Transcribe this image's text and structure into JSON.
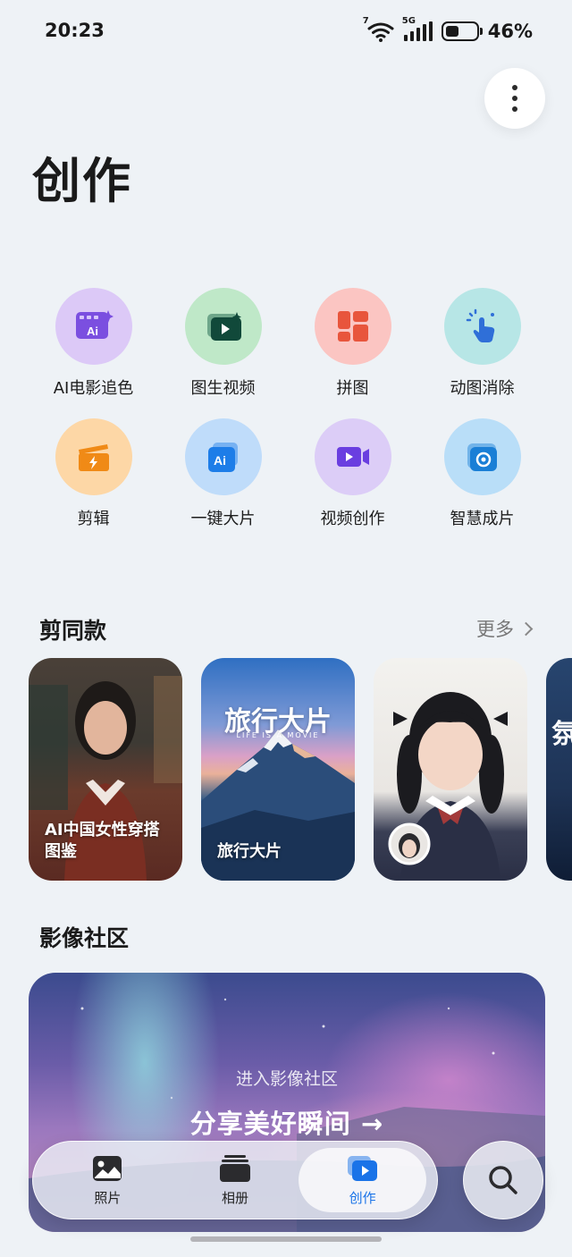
{
  "status_bar": {
    "time": "20:23",
    "network": "5G",
    "wifi_badge": "7",
    "battery": "46%",
    "battery_level": 0.46
  },
  "page": {
    "title": "创作"
  },
  "tools": [
    {
      "label": "AI电影追色",
      "icon": "ai-film-icon",
      "color": "#dcc9f7"
    },
    {
      "label": "图生视频",
      "icon": "image-to-video-icon",
      "color": "#bfe8c8"
    },
    {
      "label": "拼图",
      "icon": "collage-icon",
      "color": "#fbc5c2"
    },
    {
      "label": "动图消除",
      "icon": "motion-erase-icon",
      "color": "#b7e6e6"
    },
    {
      "label": "剪辑",
      "icon": "clip-edit-icon",
      "color": "#fdd7a6"
    },
    {
      "label": "一键大片",
      "icon": "ai-one-tap-icon",
      "color": "#bfdcfa"
    },
    {
      "label": "视频创作",
      "icon": "video-camera-icon",
      "color": "#dccdf7"
    },
    {
      "label": "智慧成片",
      "icon": "smart-film-icon",
      "color": "#b9def8"
    }
  ],
  "templates_section": {
    "title": "剪同款",
    "more_label": "更多",
    "cards": [
      {
        "label": "AI中国女性穿搭图鉴"
      },
      {
        "label": "旅行大片",
        "poster_title": "旅行大片",
        "poster_subtitle": "LIFE IS A MOVIE"
      },
      {
        "label": ""
      },
      {
        "label": "氛"
      }
    ]
  },
  "community_section": {
    "title": "影像社区",
    "banner_subtitle": "进入影像社区",
    "banner_title": "分享美好瞬间 →"
  },
  "bottom_nav": {
    "items": [
      {
        "label": "照片",
        "icon": "photo-icon",
        "active": false
      },
      {
        "label": "相册",
        "icon": "albums-icon",
        "active": false
      },
      {
        "label": "创作",
        "icon": "create-icon",
        "active": true
      }
    ],
    "search_icon": "search-icon",
    "active_color": "#1a73e8"
  }
}
